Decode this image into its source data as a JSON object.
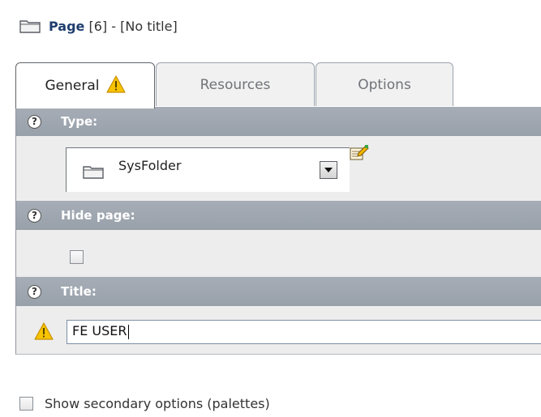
{
  "header": {
    "title_bold": "Page",
    "title_rest": " [6] - [No title]",
    "icon": "folder-icon"
  },
  "tabs": [
    {
      "label": "General",
      "active": true,
      "icon": "warning-icon"
    },
    {
      "label": "Resources",
      "active": false
    },
    {
      "label": "Options",
      "active": false
    }
  ],
  "form": {
    "type": {
      "label": "Type:",
      "value": "SysFolder",
      "icon": "folder-icon",
      "edit_icon": "edit-record-icon"
    },
    "hide_page": {
      "label": "Hide page:",
      "checked": false
    },
    "title": {
      "label": "Title:",
      "value": "FE USER",
      "icon": "warning-icon"
    }
  },
  "footer": {
    "secondary_options_label": "Show secondary options (palettes)",
    "checked": false
  },
  "colors": {
    "section_header": "#9ea6b0",
    "warning": "#f2c200",
    "title_text": "#1f3e6e"
  }
}
